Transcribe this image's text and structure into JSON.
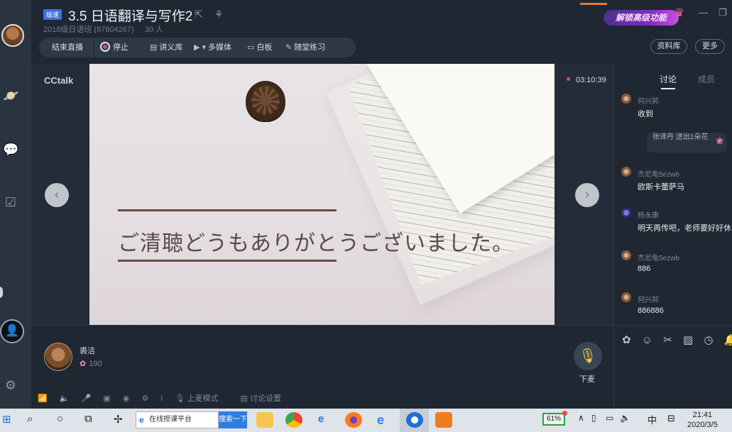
{
  "header": {
    "badge": "极速",
    "title": "3.5 日语翻译与写作2",
    "class_name": "2018级日语班 (87804267)",
    "member_count": "30 人",
    "unlock_label": "解锁高级功能",
    "resources_label": "资料库",
    "more_label": "更多"
  },
  "toolbar": {
    "end_live": "结束直播",
    "stop": "停止",
    "handout": "讲义库",
    "multimedia": "多媒体",
    "whiteboard": "白板",
    "quiz": "随堂练习"
  },
  "stage": {
    "brand": "CCtalk",
    "timer": "03:10:39",
    "slide_text": "ご清聴どうもありがとうございました。"
  },
  "teacher": {
    "name": "裘洁",
    "flowers": "190",
    "mic_label": "下麦"
  },
  "bottom_tools": {
    "mic_mode": "上麦模式",
    "discussion_settings": "讨论设置",
    "separator": "I"
  },
  "chat": {
    "tab_discussion": "讨论",
    "tab_members": "成员",
    "gift_text": "张译丹 送出1朵花",
    "messages": [
      {
        "name": "何兴邦",
        "text": "收到"
      },
      {
        "name": "杰尼龟5ezwb",
        "text": "欧斯卡蕾萨马"
      },
      {
        "name": "杨永康",
        "text": "明天再传吧，老师要好好休"
      },
      {
        "name": "杰尼龟5ezwb",
        "text": "886"
      },
      {
        "name": "何兴邦",
        "text": "886886"
      }
    ]
  },
  "taskbar": {
    "search_text": "在线授课平台",
    "search_button": "搜索一下",
    "battery": "61%",
    "ime": "中",
    "time": "21:41",
    "date": "2020/3/5"
  },
  "colors": {
    "background": "#1f2733",
    "accent_blue": "#3f6ee0",
    "record_red": "#e24b5b"
  }
}
